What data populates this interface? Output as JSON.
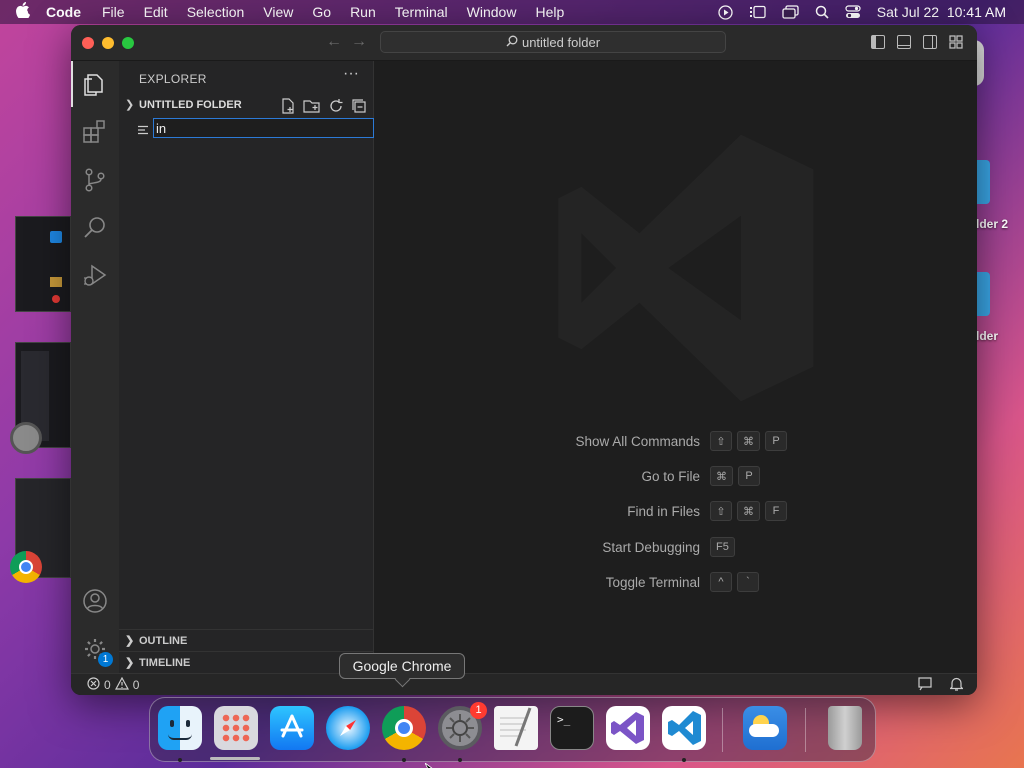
{
  "menubar": {
    "app_name": "Code",
    "items": [
      "File",
      "Edit",
      "Selection",
      "View",
      "Go",
      "Run",
      "Terminal",
      "Window",
      "Help"
    ],
    "clock": "Sat Jul 22  10:41 AM"
  },
  "window": {
    "command_center": "untitled folder"
  },
  "explorer": {
    "title": "EXPLORER",
    "more": "···",
    "folder_name": "UNTITLED FOLDER",
    "rename_value": "in",
    "outline_label": "OUTLINE",
    "timeline_label": "TIMELINE"
  },
  "activity": {
    "settings_badge": "1"
  },
  "shortcuts": [
    {
      "label": "Show All Commands",
      "keys": [
        "⇧",
        "⌘",
        "P"
      ]
    },
    {
      "label": "Go to File",
      "keys": [
        "⌘",
        "P"
      ]
    },
    {
      "label": "Find in Files",
      "keys": [
        "⇧",
        "⌘",
        "F"
      ]
    },
    {
      "label": "Start Debugging",
      "keys": [
        "F5"
      ]
    },
    {
      "label": "Toggle Terminal",
      "keys": [
        "^",
        "`"
      ]
    }
  ],
  "status": {
    "errors": "0",
    "warnings": "0"
  },
  "tooltip": "Google Chrome",
  "dock": {
    "settings_badge": "1"
  },
  "desktop": {
    "folder2_label": "lder 2",
    "folder_label": "lder"
  },
  "colors": {
    "accent": "#0078d4",
    "editor_bg": "#1e1e1e",
    "sidebar_bg": "#252526"
  }
}
